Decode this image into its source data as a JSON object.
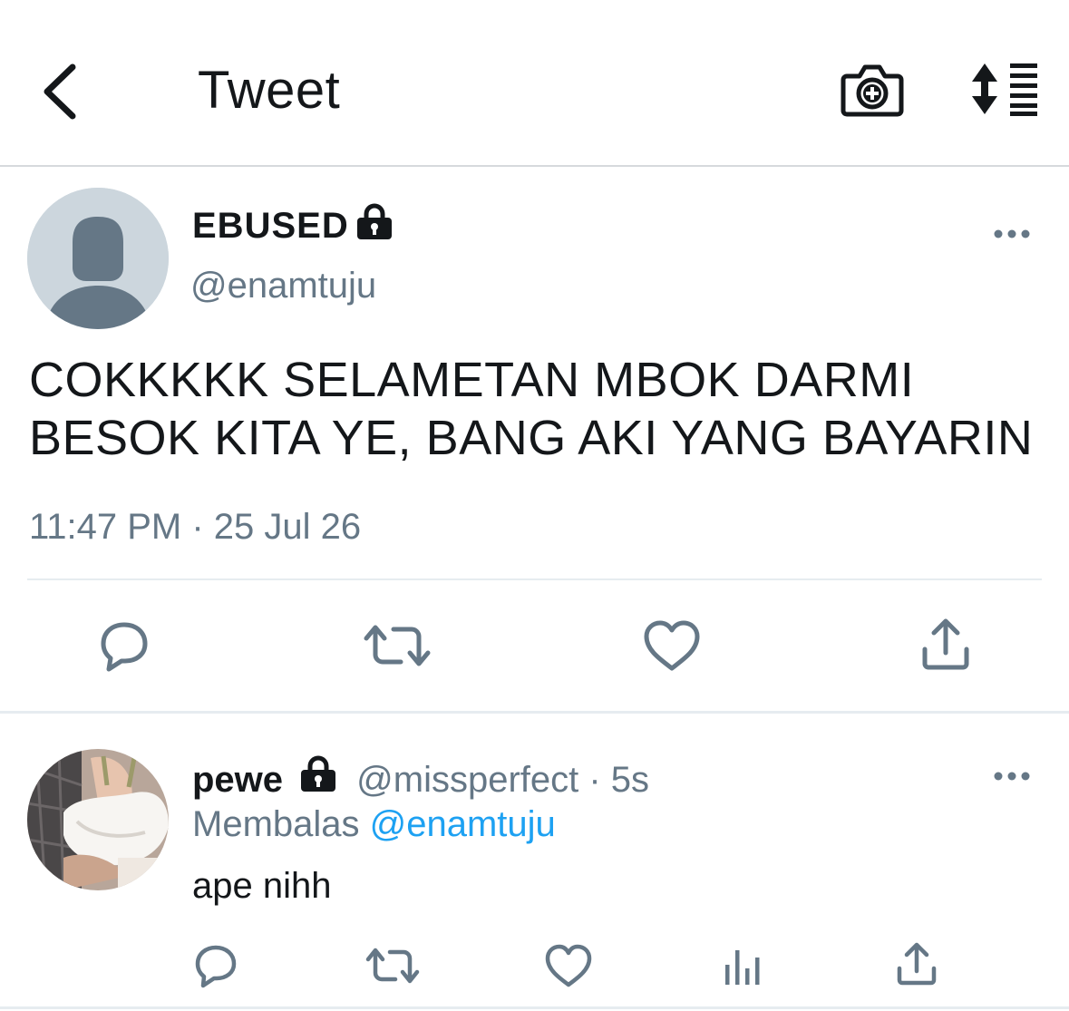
{
  "header": {
    "title": "Tweet",
    "back_icon": "chevron-left-icon",
    "camera_icon": "camera-plus-icon",
    "sort_icon": "sort-list-icon"
  },
  "main_tweet": {
    "display_name": "EBUSED",
    "handle": "@enamtuju",
    "protected": true,
    "text_lines": [
      "COKKKKK SELAMETAN MBOK DARMI",
      "BESOK KITA YE, BANG AKI YANG BAYARIN"
    ],
    "timestamp": "11:47 PM · 25 Jul 26",
    "actions": [
      "reply-icon",
      "retweet-icon",
      "like-icon",
      "share-icon"
    ]
  },
  "reply": {
    "display_name": "pewe",
    "handle_meta": " @missperfect · 5s",
    "protected": true,
    "replying_to_label": "Membalas ",
    "replying_to_handle": "@enamtuju",
    "text": "ape nihh",
    "actions": [
      "reply-icon",
      "retweet-icon",
      "like-icon",
      "stats-icon",
      "share-icon"
    ]
  },
  "colors": {
    "text_primary": "#14171a",
    "text_secondary": "#657786",
    "icon": "#657786",
    "link": "#1da1f2",
    "divider": "#e6ecf0",
    "avatar_placeholder_bg": "#ccd6dd",
    "avatar_placeholder_fg": "#657786"
  }
}
